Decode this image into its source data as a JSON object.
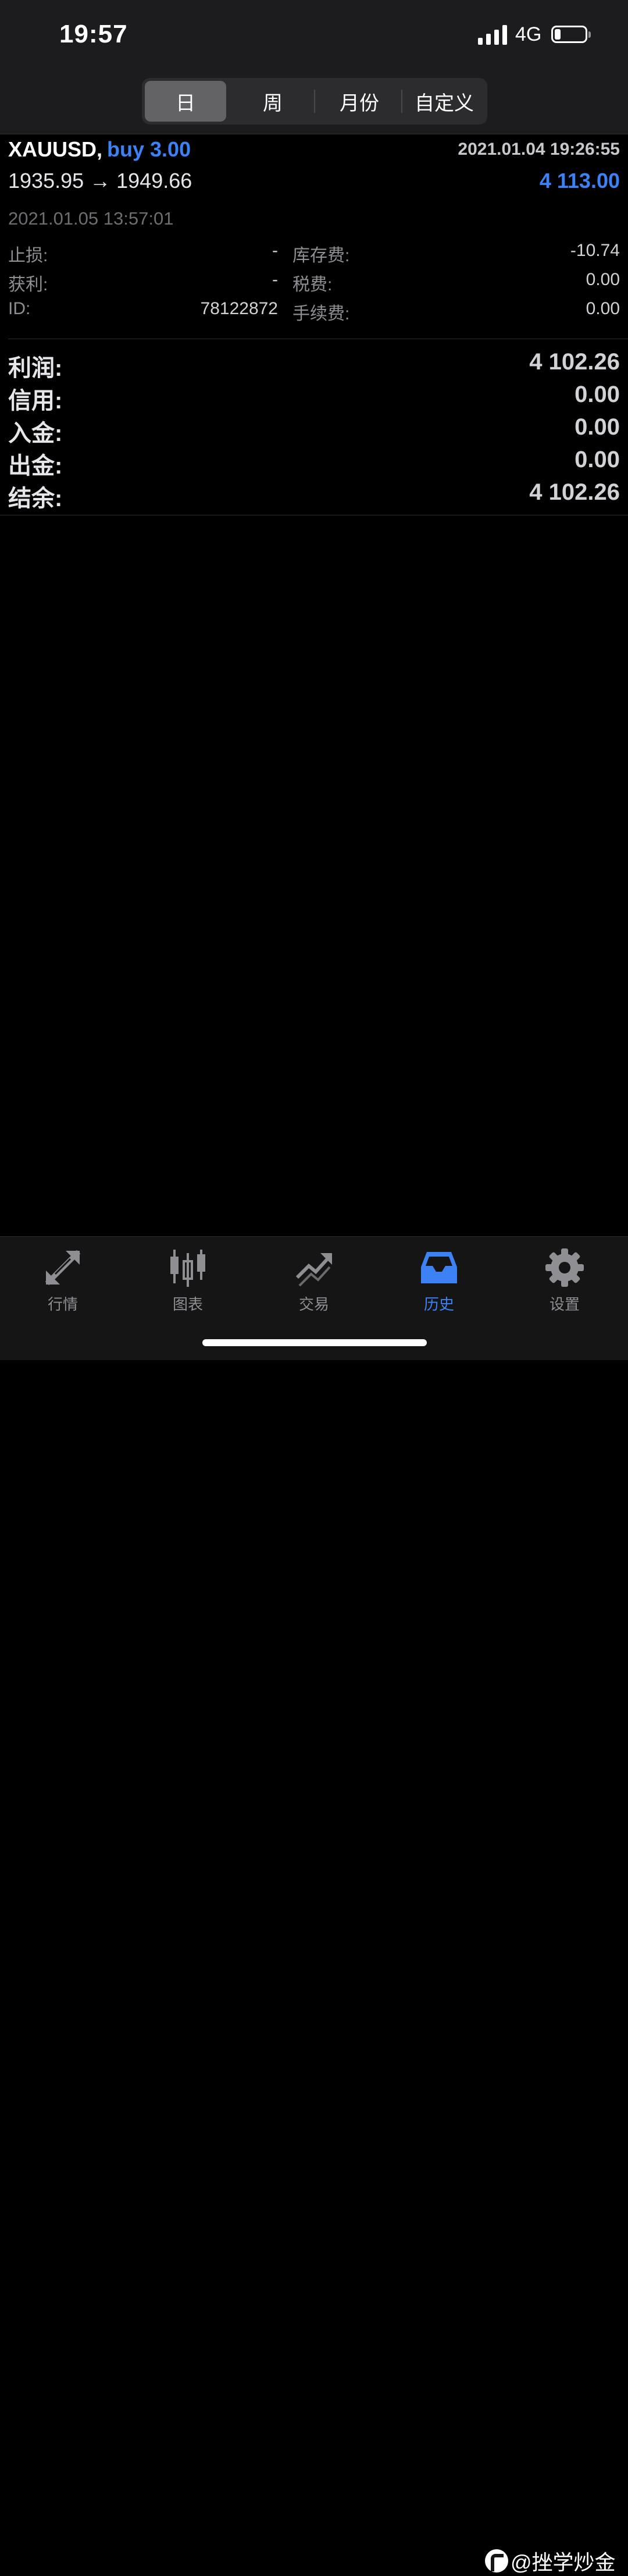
{
  "status_bar": {
    "time": "19:57",
    "network": "4G",
    "battery_level": 0.2
  },
  "period_tabs": [
    {
      "label": "日",
      "active": true
    },
    {
      "label": "周",
      "active": false
    },
    {
      "label": "月份",
      "active": false
    },
    {
      "label": "自定义",
      "active": false
    }
  ],
  "trade": {
    "symbol": "XAUUSD,",
    "direction": "buy 3.00",
    "open_time": "2021.01.04 19:26:55",
    "prices": "1935.95 → 1949.66",
    "profit": "4 113.00",
    "close_time": "2021.01.05 13:57:01",
    "details": {
      "stop_loss_label": "止损:",
      "stop_loss_value": "-",
      "take_profit_label": "获利:",
      "take_profit_value": "-",
      "id_label": "ID:",
      "id_value": "78122872",
      "swap_label": "库存费:",
      "swap_value": "-10.74",
      "tax_label": "税费:",
      "tax_value": "0.00",
      "commission_label": "手续费:",
      "commission_value": "0.00"
    }
  },
  "summary": [
    {
      "label": "利润:",
      "value": "4 102.26"
    },
    {
      "label": "信用:",
      "value": "0.00"
    },
    {
      "label": "入金:",
      "value": "0.00"
    },
    {
      "label": "出金:",
      "value": "0.00"
    },
    {
      "label": "结余:",
      "value": "4 102.26"
    }
  ],
  "tabbar": [
    {
      "label": "行情",
      "icon": "quotes-arrows-icon",
      "active": false
    },
    {
      "label": "图表",
      "icon": "candlestick-chart-icon",
      "active": false
    },
    {
      "label": "交易",
      "icon": "trade-trend-icon",
      "active": false
    },
    {
      "label": "历史",
      "icon": "history-inbox-icon",
      "active": true
    },
    {
      "label": "设置",
      "icon": "gear-icon",
      "active": false
    }
  ],
  "watermark": "@挫学炒金",
  "colors": {
    "accent": "#3d82f5",
    "background": "#000000",
    "inactive": "#8e8e93"
  }
}
